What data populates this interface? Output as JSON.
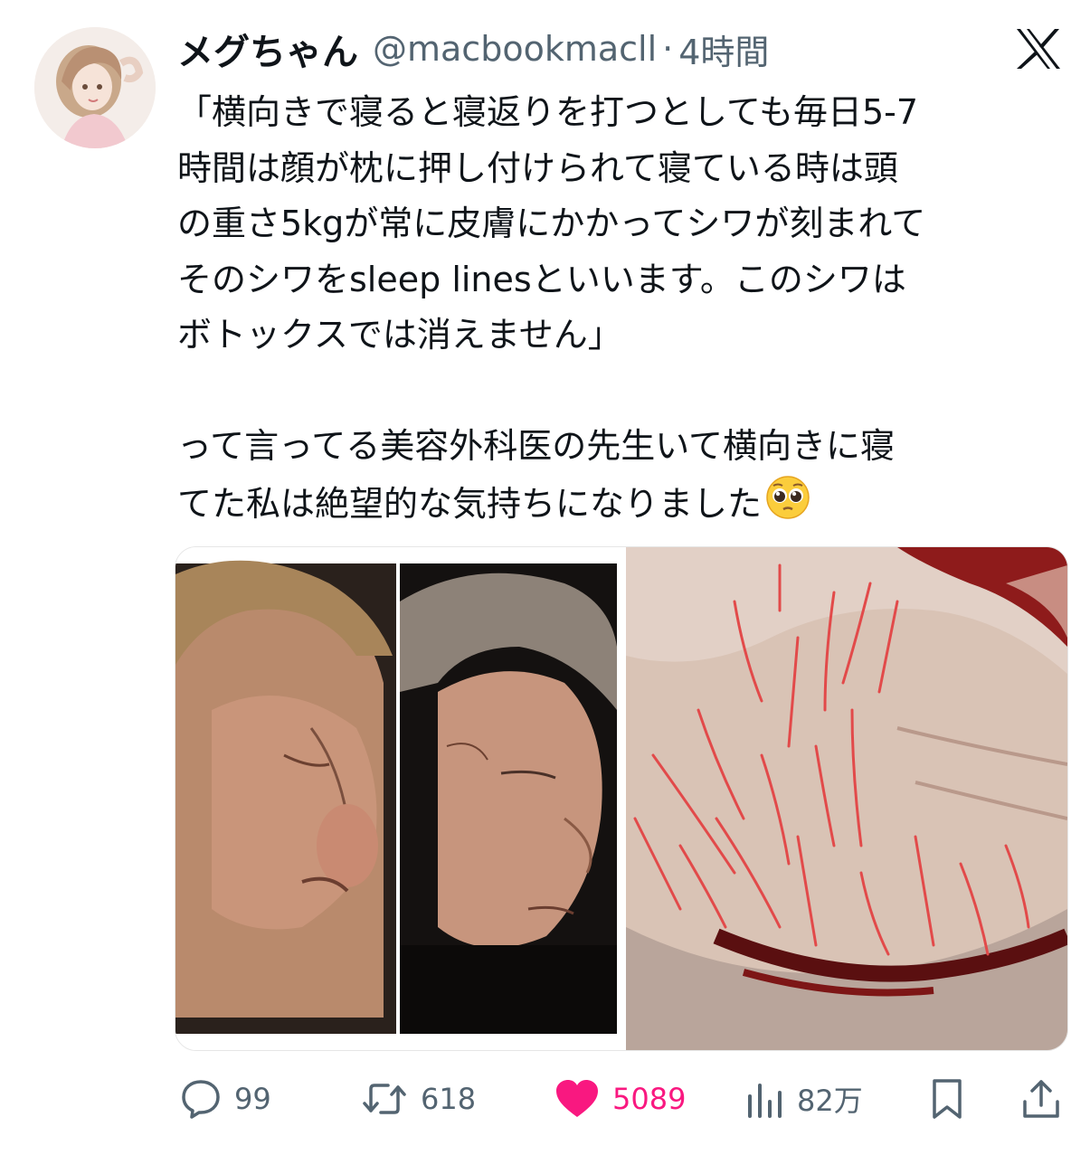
{
  "tweet": {
    "display_name": "メグちゃん",
    "handle": "@macbookmacll",
    "separator": "·",
    "time": "4時間",
    "text_lines": [
      "「横向きで寝ると寝返りを打つとしても毎日5-7",
      "時間は顔が枕に押し付けられて寝ている時は頭",
      "の重さ5kgが常に皮膚にかかってシワが刻まれて",
      "そのシワをsleep linesといいます。このシワは",
      "ボトックスでは消えません」",
      "って言ってる美容外科医の先生いて横向きに寝",
      "てた私は絶望的な気持ちになりました"
    ]
  },
  "actions": {
    "reply_count": "99",
    "retweet_count": "618",
    "like_count": "5089",
    "views_count": "82万"
  },
  "colors": {
    "text": "#0f1419",
    "secondary": "#536471",
    "like": "#f91880"
  },
  "icons": {
    "logo": "x-logo-icon",
    "reply": "speech-bubble-icon",
    "retweet": "retweet-arrows-icon",
    "like": "heart-filled-icon",
    "views": "bar-chart-icon",
    "bookmark": "bookmark-icon",
    "share": "share-upload-icon",
    "emoji": "pleading-face-emoji-icon"
  }
}
